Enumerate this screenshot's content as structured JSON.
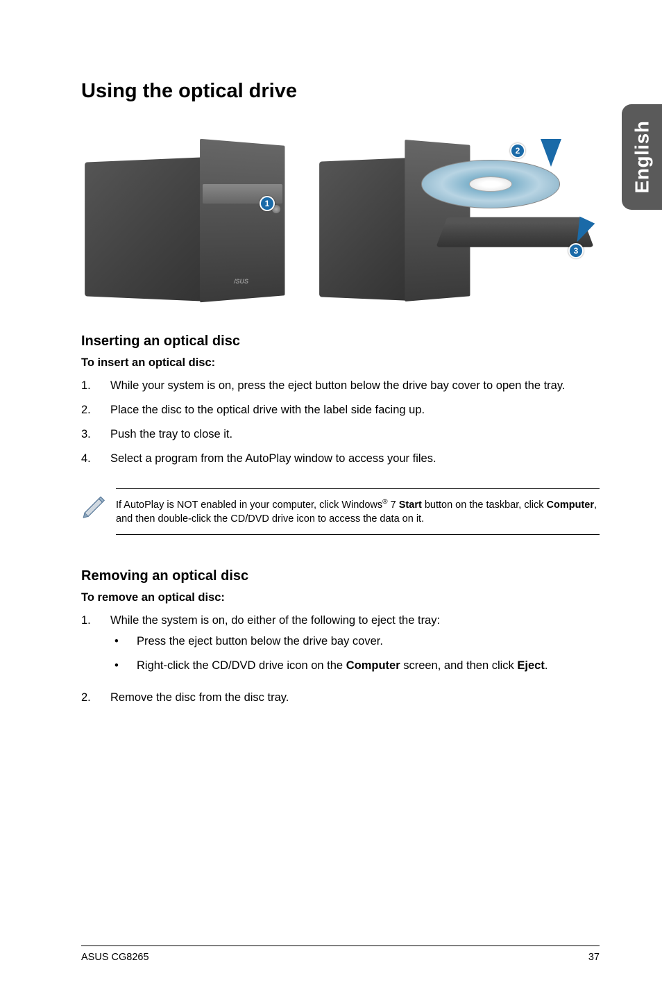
{
  "side_tab": "English",
  "main_heading": "Using the optical drive",
  "callouts": {
    "c1": "1",
    "c2": "2",
    "c3": "3"
  },
  "insert_section": {
    "heading": "Inserting an optical disc",
    "intro": "To insert an optical disc:",
    "steps": [
      "While your system is on, press the eject button below the drive bay cover to open the tray.",
      "Place the disc to the optical drive with the label side facing up.",
      "Push the tray to close it.",
      "Select a program from the AutoPlay window to access your files."
    ]
  },
  "note": {
    "pre": "If AutoPlay is NOT enabled in your computer, click Windows",
    "sup": "®",
    "mid": " 7 ",
    "bold1": "Start",
    "mid2": " button on the taskbar, click ",
    "bold2": "Computer",
    "post": ", and then double-click the CD/DVD drive icon to access the data on it."
  },
  "remove_section": {
    "heading": "Removing an optical disc",
    "intro": "To remove an optical disc:",
    "step1": "While the system is on, do either of the following to eject the tray:",
    "bullets": {
      "b1": "Press the eject button below the drive bay cover.",
      "b2_pre": "Right-click the CD/DVD drive icon on the ",
      "b2_bold1": "Computer",
      "b2_mid": " screen, and then click ",
      "b2_bold2": "Eject",
      "b2_post": "."
    },
    "step2": "Remove the disc from the disc tray."
  },
  "footer": {
    "left": "ASUS CG8265",
    "right": "37"
  }
}
